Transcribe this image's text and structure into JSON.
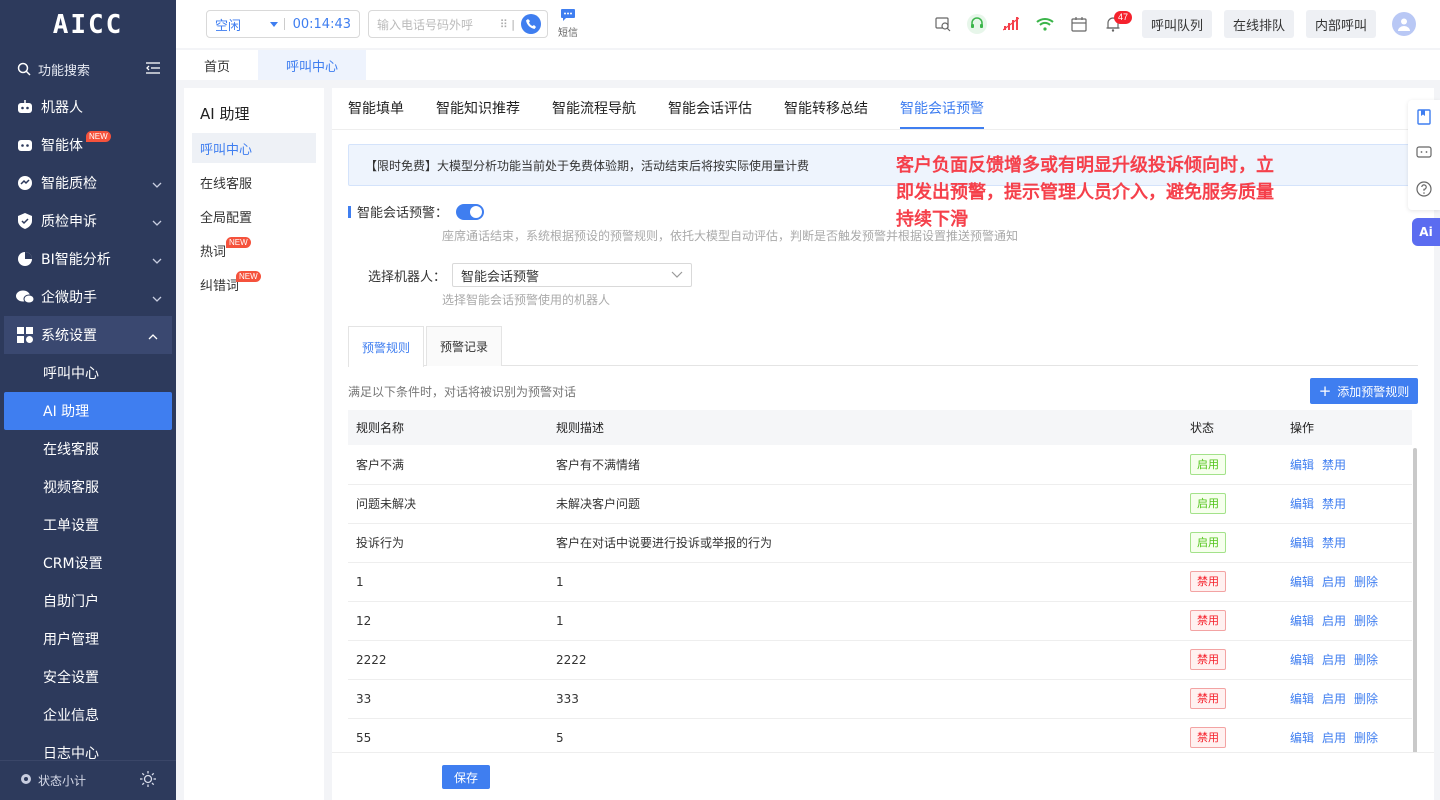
{
  "app": {
    "logo": "AICC"
  },
  "sidebar": {
    "search_label": "功能搜索",
    "items": [
      {
        "label": "机器人",
        "icon": "robot-icon"
      },
      {
        "label": "智能体",
        "icon": "agent-icon",
        "badge": "NEW"
      },
      {
        "label": "智能质检",
        "icon": "quality-icon"
      },
      {
        "label": "质检申诉",
        "icon": "shield-icon"
      },
      {
        "label": "BI智能分析",
        "icon": "pie-icon"
      },
      {
        "label": "企微助手",
        "icon": "wechat-icon"
      },
      {
        "label": "系统设置",
        "icon": "grid-icon"
      }
    ],
    "sub_items": [
      "呼叫中心",
      "AI 助理",
      "在线客服",
      "视频客服",
      "工单设置",
      "CRM设置",
      "自助门户",
      "用户管理",
      "安全设置",
      "企业信息",
      "日志中心"
    ],
    "footer_label": "状态小计"
  },
  "topbar": {
    "status": "空闲",
    "timer": "00:14:43",
    "phone_placeholder": "输入电话号码外呼",
    "sms_label": "短信",
    "notif_count": "47",
    "btn_queue": "呼叫队列",
    "btn_online_queue": "在线排队",
    "btn_internal": "内部呼叫"
  },
  "page_tabs": [
    "首页",
    "呼叫中心"
  ],
  "subnav": {
    "title": "AI 助理",
    "items": [
      {
        "label": "呼叫中心"
      },
      {
        "label": "在线客服"
      },
      {
        "label": "全局配置"
      },
      {
        "label": "热词",
        "badge": "NEW"
      },
      {
        "label": "纠错词",
        "badge": "NEW"
      }
    ]
  },
  "main": {
    "tabs": [
      "智能填单",
      "智能知识推荐",
      "智能流程导航",
      "智能会话评估",
      "智能转移总结",
      "智能会话预警"
    ],
    "notice": "【限时免费】大模型分析功能当前处于免费体验期，活动结束后将按实际使用量计费",
    "annotation": "客户负面反馈增多或有明显升级投诉倾向时，立即发出预警，提示管理人员介入，避免服务质量持续下滑",
    "warning_label": "智能会话预警：",
    "warning_hint": "座席通话结束，系统根据预设的预警规则，依托大模型自动评估，判断是否触发预警并根据设置推送预警通知",
    "robot_label": "选择机器人：",
    "robot_value": "智能会话预警",
    "robot_hint": "选择智能会话预警使用的机器人",
    "rule_tabs": [
      "预警规则",
      "预警记录"
    ],
    "condition_text": "满足以下条件时，对话将被识别为预警对话",
    "add_button": "添加预警规则",
    "table": {
      "headers": [
        "规则名称",
        "规则描述",
        "状态",
        "操作"
      ],
      "rows": [
        {
          "name": "客户不满",
          "desc": "客户有不满情绪",
          "status": "启用",
          "ops": [
            "编辑",
            "禁用"
          ]
        },
        {
          "name": "问题未解决",
          "desc": "未解决客户问题",
          "status": "启用",
          "ops": [
            "编辑",
            "禁用"
          ]
        },
        {
          "name": "投诉行为",
          "desc": "客户在对话中说要进行投诉或举报的行为",
          "status": "启用",
          "ops": [
            "编辑",
            "禁用"
          ]
        },
        {
          "name": "1",
          "desc": "1",
          "status": "禁用",
          "ops": [
            "编辑",
            "启用",
            "删除"
          ]
        },
        {
          "name": "12",
          "desc": "1",
          "status": "禁用",
          "ops": [
            "编辑",
            "启用",
            "删除"
          ]
        },
        {
          "name": "2222",
          "desc": "2222",
          "status": "禁用",
          "ops": [
            "编辑",
            "启用",
            "删除"
          ]
        },
        {
          "name": "33",
          "desc": "333",
          "status": "禁用",
          "ops": [
            "编辑",
            "启用",
            "删除"
          ]
        },
        {
          "name": "55",
          "desc": "5",
          "status": "禁用",
          "ops": [
            "编辑",
            "启用",
            "删除"
          ]
        }
      ]
    },
    "save_button": "保存"
  },
  "ai_fab": "Ai",
  "colors": {
    "accent": "#3f7ef0",
    "sidebar_bg": "#2d3a5c",
    "annotation": "#f5404b",
    "enabled": "#52c41a",
    "disabled": "#f5222d"
  }
}
